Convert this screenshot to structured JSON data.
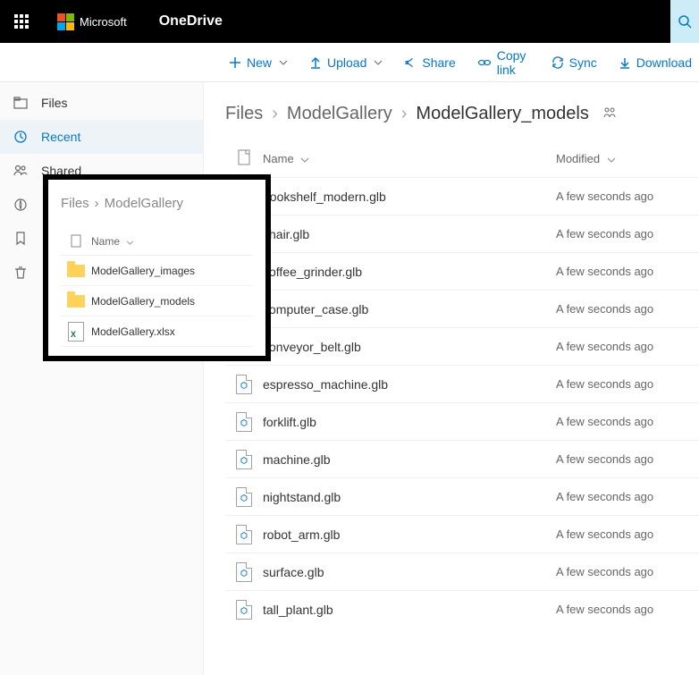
{
  "header": {
    "microsoft": "Microsoft",
    "app": "OneDrive"
  },
  "toolbar": {
    "new": "New",
    "upload": "Upload",
    "share": "Share",
    "copylink": "Copy link",
    "sync": "Sync",
    "download": "Download"
  },
  "sidebar": {
    "files": "Files",
    "recent": "Recent",
    "shared": "Shared"
  },
  "breadcrumb": {
    "root": "Files",
    "mid": "ModelGallery",
    "current": "ModelGallery_models"
  },
  "columns": {
    "name": "Name",
    "modified": "Modified"
  },
  "files": [
    {
      "name": "bookshelf_modern.glb",
      "modified": "A few seconds ago"
    },
    {
      "name": "chair.glb",
      "modified": "A few seconds ago"
    },
    {
      "name": "coffee_grinder.glb",
      "modified": "A few seconds ago"
    },
    {
      "name": "computer_case.glb",
      "modified": "A few seconds ago"
    },
    {
      "name": "conveyor_belt.glb",
      "modified": "A few seconds ago"
    },
    {
      "name": "espresso_machine.glb",
      "modified": "A few seconds ago"
    },
    {
      "name": "forklift.glb",
      "modified": "A few seconds ago"
    },
    {
      "name": "machine.glb",
      "modified": "A few seconds ago"
    },
    {
      "name": "nightstand.glb",
      "modified": "A few seconds ago"
    },
    {
      "name": "robot_arm.glb",
      "modified": "A few seconds ago"
    },
    {
      "name": "surface.glb",
      "modified": "A few seconds ago"
    },
    {
      "name": "tall_plant.glb",
      "modified": "A few seconds ago"
    }
  ],
  "inset": {
    "crumb_root": "Files",
    "crumb_current": "ModelGallery",
    "col_name": "Name",
    "items": [
      {
        "type": "folder",
        "name": "ModelGallery_images"
      },
      {
        "type": "folder",
        "name": "ModelGallery_models"
      },
      {
        "type": "xlsx",
        "name": "ModelGallery.xlsx"
      }
    ]
  }
}
